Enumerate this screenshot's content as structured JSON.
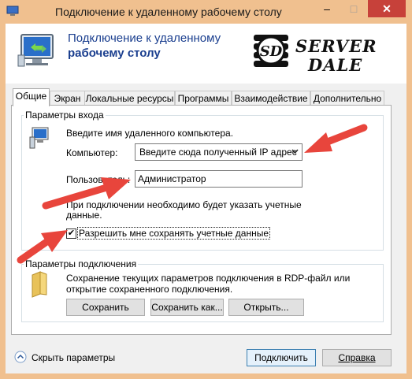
{
  "window": {
    "title": "Подключение к удаленному рабочему столу",
    "minimize": "–",
    "maximize": "□",
    "close": "✕"
  },
  "header": {
    "line1": "Подключение к удаленному",
    "line2": "рабочему столу",
    "logo_line1": "SERVER",
    "logo_line2": "DALE",
    "logo_badge": "SD"
  },
  "tabs": [
    {
      "label": "Общие",
      "active": true
    },
    {
      "label": "Экран"
    },
    {
      "label": "Локальные ресурсы"
    },
    {
      "label": "Программы"
    },
    {
      "label": "Взаимодействие"
    },
    {
      "label": "Дополнительно"
    }
  ],
  "login_group": {
    "title": "Параметры входа",
    "prompt": "Введите имя удаленного компьютера.",
    "computer_label": "Компьютер:",
    "computer_value": "Введите сюда полученный IP адрес",
    "user_label": "Пользователь:",
    "user_value": "Администратор",
    "note_line1": "При подключении необходимо будет указать учетные",
    "note_line2": "данные.",
    "save_creds_label": "Разрешить мне сохранять учетные данные",
    "save_creds_checked": true,
    "check_glyph": "✔"
  },
  "connection_group": {
    "title": "Параметры подключения",
    "desc_line1": "Сохранение текущих параметров подключения в RDP-файл или",
    "desc_line2": "открытие сохраненного подключения.",
    "save_button": "Сохранить",
    "save_as_button": "Сохранить как...",
    "open_button": "Открыть..."
  },
  "footer": {
    "hide_options": "Скрыть параметры",
    "connect_button": "Подключить",
    "help_button": "Справка"
  },
  "colors": {
    "title_bar": "#f0c08f",
    "close_button": "#c7413a",
    "header_text": "#1b3f8f",
    "annotation_arrow": "#e8453c"
  }
}
